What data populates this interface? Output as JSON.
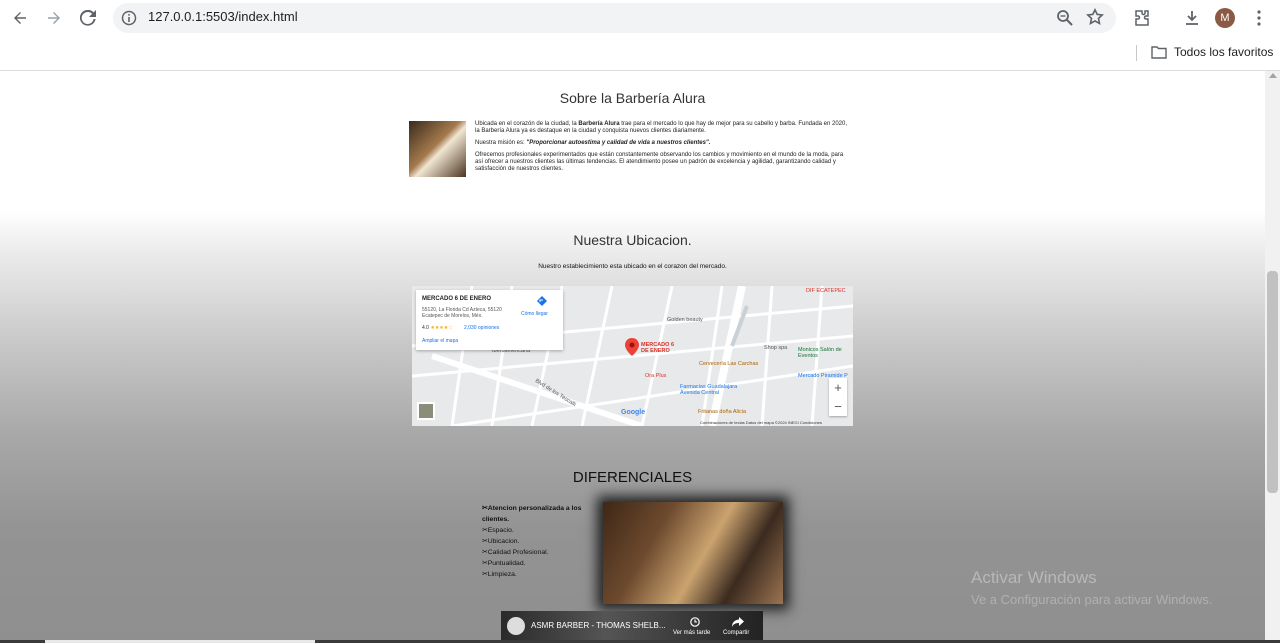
{
  "browser": {
    "url": "127.0.0.1:5503/index.html",
    "bookmarks_folder": "Todos los favoritos",
    "avatar_letter": "M"
  },
  "about": {
    "title": "Sobre la Barbería Alura",
    "p1_prefix": "Ubicada en el corazón de la ciudad, la ",
    "p1_bold": "Barbería Alura",
    "p1_suffix": " trae para el mercado lo que hay de mejor para su cabello y barba. Fundada en 2020, la Barbería Alura ya es destaque en la ciudad y conquista nuevos clientes diariamente.",
    "p2_prefix": "Nuestra misión es: ",
    "p2_bold": "\"Proporcionar autoestima y calidad de vida a nuestros clientes\".",
    "p3": "Ofrecemos profesionales experimentados que están constantemente observando los cambios y movimiento en el mundo de la moda, para así ofrecer a nuestros clientes las últimas tendencias. El atendimiento posee un padrón de excelencia y agilidad, garantizando calidad y satisfacción de nuestros clientes."
  },
  "location": {
    "title": "Nuestra Ubicacion.",
    "subtitle": "Nuestro establecimiento esta ubicado en el corazon del mercado.",
    "map": {
      "place_name": "MERCADO 6 DE ENERO",
      "address": "55120, La Florida Cd Azteca, 55120 Ecatepec de Morelos, Méx.",
      "rating": "4.0",
      "reviews": "2,030 opiniones",
      "directions": "Cómo llegar",
      "enlarge": "Ampliar el mapa",
      "zoom_in": "+",
      "zoom_out": "−",
      "google": "Google",
      "footer": "Combinaciones de teclas    Datos del mapa ©2024 INEGI    Condiciones",
      "labels": [
        "DIF ECATEPEC",
        "Golden beauty",
        "Shop spa",
        "Monicos Salón de Eventos",
        "Cervecería Las Carchas",
        "Mercado Piramide P",
        "Farmacias Guadalajara Avenida Central",
        "Fritanas doña Alicia",
        "Blvd de los Teocalli",
        "Universidad Iberoamericana",
        "Ora Plus",
        "MERCADO 6 DE ENERO"
      ]
    }
  },
  "differentials": {
    "title": "DIFERENCIALES",
    "items": [
      "Atencion personalizada a los clientes.",
      "Espacio.",
      "Ubicacion.",
      "Calidad Profesional.",
      "Puntualidad.",
      "Limpieza."
    ],
    "bullet": "✂"
  },
  "video": {
    "title": "ASMR BARBER - THOMAS SHELB...",
    "watch_later": "Ver más tarde",
    "share": "Compartir"
  },
  "watermark": {
    "line1": "Activar Windows",
    "line2": "Ve a Configuración para activar Windows."
  },
  "colors": {
    "map_pin": "#ea4335",
    "link": "#1a73e8"
  }
}
